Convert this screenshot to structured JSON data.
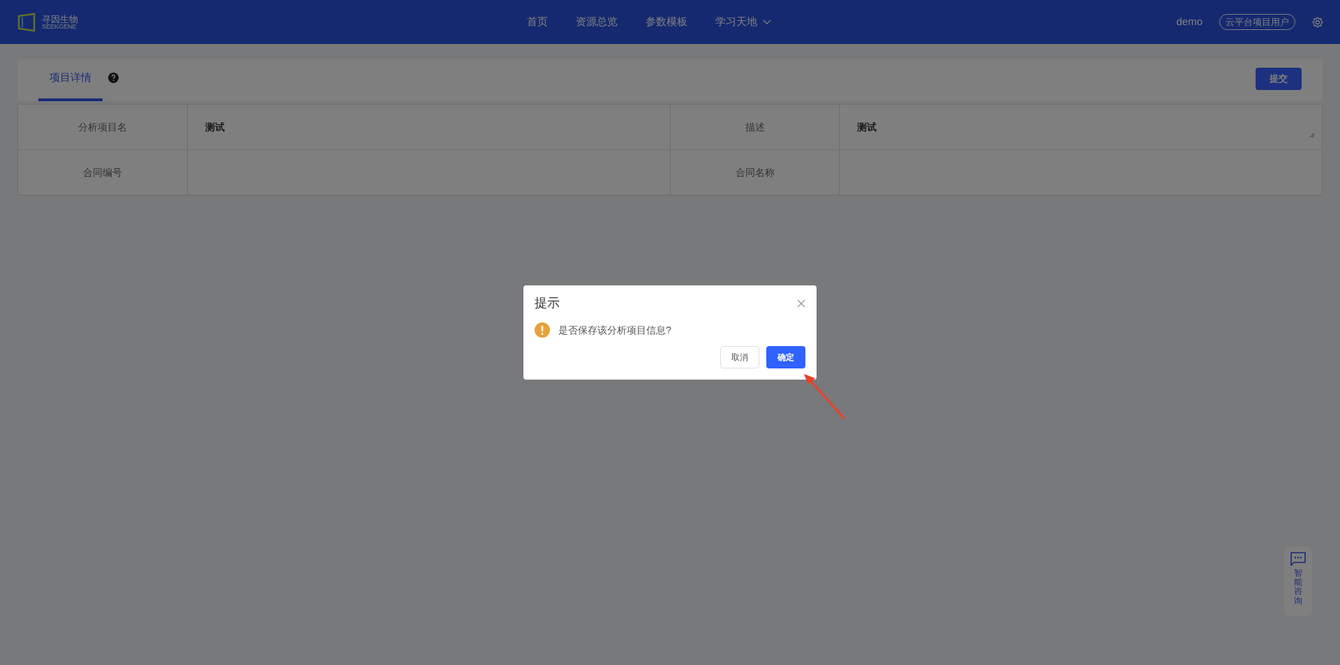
{
  "header": {
    "logo_text": "寻因生物",
    "logo_subtext": "SEEKGENE",
    "nav": [
      {
        "label": "首页",
        "dropdown": false
      },
      {
        "label": "资源总览",
        "dropdown": false
      },
      {
        "label": "参数模板",
        "dropdown": false
      },
      {
        "label": "学习天地",
        "dropdown": true
      }
    ],
    "user": "demo",
    "role_badge": "云平台项目用户"
  },
  "tabs": [
    {
      "label": "项目详情",
      "selected": true
    }
  ],
  "submit_button": "提交",
  "form": [
    [
      {
        "label": "分析项目名",
        "value": "测试",
        "kind": "input"
      },
      {
        "label": "描述",
        "value": "测试",
        "kind": "textarea"
      }
    ],
    [
      {
        "label": "合同编号",
        "kind": "input"
      },
      {
        "label": "合同名称",
        "kind": "input"
      }
    ]
  ],
  "dialog": {
    "title": "提示",
    "message": "是否保存该分析项目信息?",
    "buttons": [
      {
        "label": "取消",
        "kind": "default"
      },
      {
        "label": "确定",
        "kind": "primary"
      }
    ]
  },
  "assistant": {
    "label": "智能咨询"
  }
}
